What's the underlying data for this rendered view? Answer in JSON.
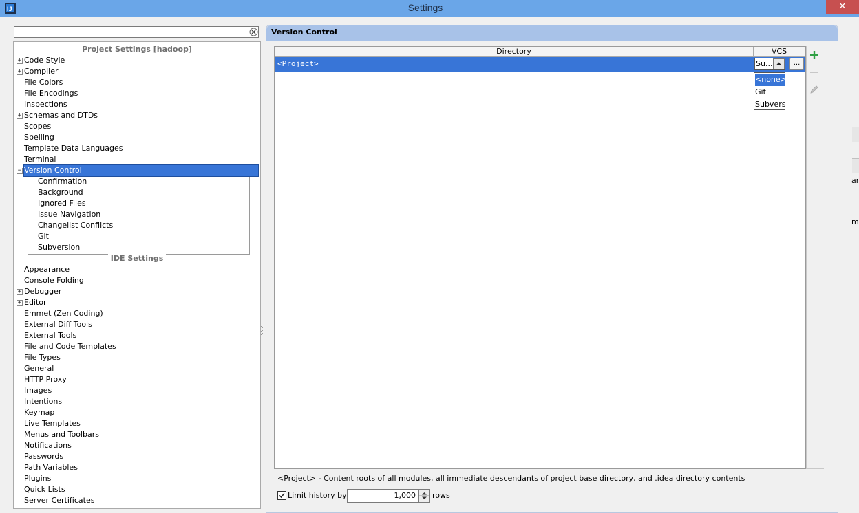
{
  "window": {
    "title": "Settings"
  },
  "search": {
    "value": "",
    "placeholder": ""
  },
  "tree": {
    "project_section": "Project Settings [hadoop]",
    "project_items": [
      {
        "label": "Code Style",
        "expandable": true
      },
      {
        "label": "Compiler",
        "expandable": true
      },
      {
        "label": "File Colors",
        "expandable": false
      },
      {
        "label": "File Encodings",
        "expandable": false
      },
      {
        "label": "Inspections",
        "expandable": false
      },
      {
        "label": "Schemas and DTDs",
        "expandable": true
      },
      {
        "label": "Scopes",
        "expandable": false
      },
      {
        "label": "Spelling",
        "expandable": false
      },
      {
        "label": "Template Data Languages",
        "expandable": false
      },
      {
        "label": "Terminal",
        "expandable": false
      },
      {
        "label": "Version Control",
        "expandable": true,
        "expanded": true,
        "selected": true
      }
    ],
    "version_control_children": [
      "Confirmation",
      "Background",
      "Ignored Files",
      "Issue Navigation",
      "Changelist Conflicts",
      "Git",
      "Subversion"
    ],
    "ide_section": "IDE Settings",
    "ide_items": [
      {
        "label": "Appearance",
        "expandable": false
      },
      {
        "label": "Console Folding",
        "expandable": false
      },
      {
        "label": "Debugger",
        "expandable": true
      },
      {
        "label": "Editor",
        "expandable": true
      },
      {
        "label": "Emmet (Zen Coding)",
        "expandable": false
      },
      {
        "label": "External Diff Tools",
        "expandable": false
      },
      {
        "label": "External Tools",
        "expandable": false
      },
      {
        "label": "File and Code Templates",
        "expandable": false
      },
      {
        "label": "File Types",
        "expandable": false
      },
      {
        "label": "General",
        "expandable": false
      },
      {
        "label": "HTTP Proxy",
        "expandable": false
      },
      {
        "label": "Images",
        "expandable": false
      },
      {
        "label": "Intentions",
        "expandable": false
      },
      {
        "label": "Keymap",
        "expandable": false
      },
      {
        "label": "Live Templates",
        "expandable": false
      },
      {
        "label": "Menus and Toolbars",
        "expandable": false
      },
      {
        "label": "Notifications",
        "expandable": false
      },
      {
        "label": "Passwords",
        "expandable": false
      },
      {
        "label": "Path Variables",
        "expandable": false
      },
      {
        "label": "Plugins",
        "expandable": false
      },
      {
        "label": "Quick Lists",
        "expandable": false
      },
      {
        "label": "Server Certificates",
        "expandable": false
      }
    ]
  },
  "panel": {
    "title": "Version Control",
    "table": {
      "columns": [
        "Directory",
        "VCS"
      ],
      "rows": [
        {
          "directory": "<Project>",
          "vcs": "Su..."
        }
      ],
      "more_button": "..."
    },
    "vcs_dropdown": {
      "options": [
        "<none>",
        "Git",
        "Subversi"
      ],
      "selected_index": 0
    },
    "description": "<Project> - Content roots of all modules, all immediate descendants of project base directory, and .idea directory contents",
    "limit_history": {
      "checked": true,
      "label": "Limit history by:",
      "value": "1,000",
      "suffix": "rows"
    }
  },
  "edge_fragments": [
    "ar",
    "me"
  ],
  "colors": {
    "title_bar": "#6aa6e8",
    "selection": "#3875d7",
    "panel_header": "#a8c2e8",
    "add_green": "#2ea043"
  },
  "icons": {
    "app": "intellij-app-icon",
    "clear": "clear-search-icon",
    "add": "plus-icon",
    "remove": "minus-icon",
    "edit": "pencil-icon"
  }
}
